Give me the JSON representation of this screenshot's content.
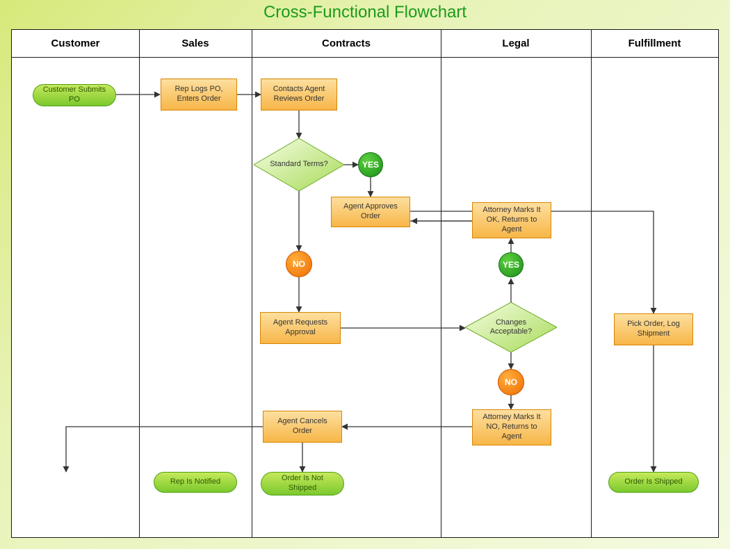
{
  "title": "Cross-Functional Flowchart",
  "lanes": {
    "customer": "Customer",
    "sales": "Sales",
    "contracts": "Contracts",
    "legal": "Legal",
    "fulfillment": "Fulfillment"
  },
  "nodes": {
    "customer_submits": "Customer Submits PO",
    "rep_logs": "Rep Logs PO, Enters Order",
    "contacts_agent": "Contacts Agent Reviews Order",
    "standard_terms": "Standard Terms?",
    "yes1": "YES",
    "agent_approves": "Agent Approves Order",
    "no1": "NO",
    "agent_requests": "Agent Requests Approval",
    "changes_acc": "Changes Acceptable?",
    "yes2": "YES",
    "attorney_ok": "Attorney Marks It OK, Returns to Agent",
    "no2": "NO",
    "attorney_no": "Attorney Marks It NO, Returns to Agent",
    "agent_cancels": "Agent Cancels Order",
    "order_not_shipped": "Order Is Not Shipped",
    "rep_notified": "Rep Is Notified",
    "pick_order": "Pick Order, Log Shipment",
    "order_shipped": "Order Is Shipped"
  }
}
